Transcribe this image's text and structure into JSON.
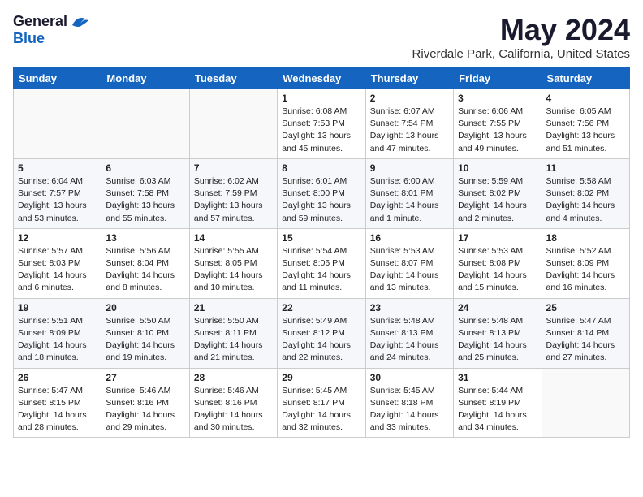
{
  "header": {
    "logo_general": "General",
    "logo_blue": "Blue",
    "month": "May 2024",
    "location": "Riverdale Park, California, United States"
  },
  "weekdays": [
    "Sunday",
    "Monday",
    "Tuesday",
    "Wednesday",
    "Thursday",
    "Friday",
    "Saturday"
  ],
  "weeks": [
    [
      {
        "day": "",
        "info": ""
      },
      {
        "day": "",
        "info": ""
      },
      {
        "day": "",
        "info": ""
      },
      {
        "day": "1",
        "info": "Sunrise: 6:08 AM\nSunset: 7:53 PM\nDaylight: 13 hours\nand 45 minutes."
      },
      {
        "day": "2",
        "info": "Sunrise: 6:07 AM\nSunset: 7:54 PM\nDaylight: 13 hours\nand 47 minutes."
      },
      {
        "day": "3",
        "info": "Sunrise: 6:06 AM\nSunset: 7:55 PM\nDaylight: 13 hours\nand 49 minutes."
      },
      {
        "day": "4",
        "info": "Sunrise: 6:05 AM\nSunset: 7:56 PM\nDaylight: 13 hours\nand 51 minutes."
      }
    ],
    [
      {
        "day": "5",
        "info": "Sunrise: 6:04 AM\nSunset: 7:57 PM\nDaylight: 13 hours\nand 53 minutes."
      },
      {
        "day": "6",
        "info": "Sunrise: 6:03 AM\nSunset: 7:58 PM\nDaylight: 13 hours\nand 55 minutes."
      },
      {
        "day": "7",
        "info": "Sunrise: 6:02 AM\nSunset: 7:59 PM\nDaylight: 13 hours\nand 57 minutes."
      },
      {
        "day": "8",
        "info": "Sunrise: 6:01 AM\nSunset: 8:00 PM\nDaylight: 13 hours\nand 59 minutes."
      },
      {
        "day": "9",
        "info": "Sunrise: 6:00 AM\nSunset: 8:01 PM\nDaylight: 14 hours\nand 1 minute."
      },
      {
        "day": "10",
        "info": "Sunrise: 5:59 AM\nSunset: 8:02 PM\nDaylight: 14 hours\nand 2 minutes."
      },
      {
        "day": "11",
        "info": "Sunrise: 5:58 AM\nSunset: 8:02 PM\nDaylight: 14 hours\nand 4 minutes."
      }
    ],
    [
      {
        "day": "12",
        "info": "Sunrise: 5:57 AM\nSunset: 8:03 PM\nDaylight: 14 hours\nand 6 minutes."
      },
      {
        "day": "13",
        "info": "Sunrise: 5:56 AM\nSunset: 8:04 PM\nDaylight: 14 hours\nand 8 minutes."
      },
      {
        "day": "14",
        "info": "Sunrise: 5:55 AM\nSunset: 8:05 PM\nDaylight: 14 hours\nand 10 minutes."
      },
      {
        "day": "15",
        "info": "Sunrise: 5:54 AM\nSunset: 8:06 PM\nDaylight: 14 hours\nand 11 minutes."
      },
      {
        "day": "16",
        "info": "Sunrise: 5:53 AM\nSunset: 8:07 PM\nDaylight: 14 hours\nand 13 minutes."
      },
      {
        "day": "17",
        "info": "Sunrise: 5:53 AM\nSunset: 8:08 PM\nDaylight: 14 hours\nand 15 minutes."
      },
      {
        "day": "18",
        "info": "Sunrise: 5:52 AM\nSunset: 8:09 PM\nDaylight: 14 hours\nand 16 minutes."
      }
    ],
    [
      {
        "day": "19",
        "info": "Sunrise: 5:51 AM\nSunset: 8:09 PM\nDaylight: 14 hours\nand 18 minutes."
      },
      {
        "day": "20",
        "info": "Sunrise: 5:50 AM\nSunset: 8:10 PM\nDaylight: 14 hours\nand 19 minutes."
      },
      {
        "day": "21",
        "info": "Sunrise: 5:50 AM\nSunset: 8:11 PM\nDaylight: 14 hours\nand 21 minutes."
      },
      {
        "day": "22",
        "info": "Sunrise: 5:49 AM\nSunset: 8:12 PM\nDaylight: 14 hours\nand 22 minutes."
      },
      {
        "day": "23",
        "info": "Sunrise: 5:48 AM\nSunset: 8:13 PM\nDaylight: 14 hours\nand 24 minutes."
      },
      {
        "day": "24",
        "info": "Sunrise: 5:48 AM\nSunset: 8:13 PM\nDaylight: 14 hours\nand 25 minutes."
      },
      {
        "day": "25",
        "info": "Sunrise: 5:47 AM\nSunset: 8:14 PM\nDaylight: 14 hours\nand 27 minutes."
      }
    ],
    [
      {
        "day": "26",
        "info": "Sunrise: 5:47 AM\nSunset: 8:15 PM\nDaylight: 14 hours\nand 28 minutes."
      },
      {
        "day": "27",
        "info": "Sunrise: 5:46 AM\nSunset: 8:16 PM\nDaylight: 14 hours\nand 29 minutes."
      },
      {
        "day": "28",
        "info": "Sunrise: 5:46 AM\nSunset: 8:16 PM\nDaylight: 14 hours\nand 30 minutes."
      },
      {
        "day": "29",
        "info": "Sunrise: 5:45 AM\nSunset: 8:17 PM\nDaylight: 14 hours\nand 32 minutes."
      },
      {
        "day": "30",
        "info": "Sunrise: 5:45 AM\nSunset: 8:18 PM\nDaylight: 14 hours\nand 33 minutes."
      },
      {
        "day": "31",
        "info": "Sunrise: 5:44 AM\nSunset: 8:19 PM\nDaylight: 14 hours\nand 34 minutes."
      },
      {
        "day": "",
        "info": ""
      }
    ]
  ]
}
